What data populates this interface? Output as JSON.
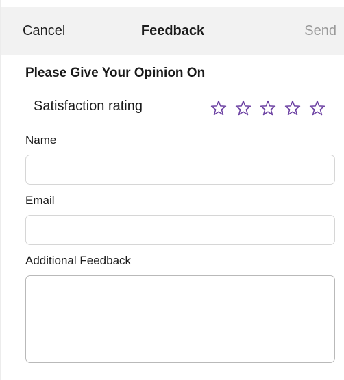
{
  "navbar": {
    "cancel_label": "Cancel",
    "title": "Feedback",
    "send_label": "Send"
  },
  "form": {
    "heading": "Please Give Your Opinion On",
    "rating": {
      "label": "Satisfaction rating",
      "max_stars": 5,
      "selected": 0,
      "star_color": "#6a3ea1"
    },
    "name": {
      "label": "Name",
      "value": "",
      "placeholder": ""
    },
    "email": {
      "label": "Email",
      "value": "",
      "placeholder": ""
    },
    "feedback": {
      "label": "Additional Feedback",
      "value": "",
      "placeholder": ""
    }
  },
  "colors": {
    "navbar_bg": "#f2f2f2",
    "send_disabled": "#9a9a9a"
  }
}
